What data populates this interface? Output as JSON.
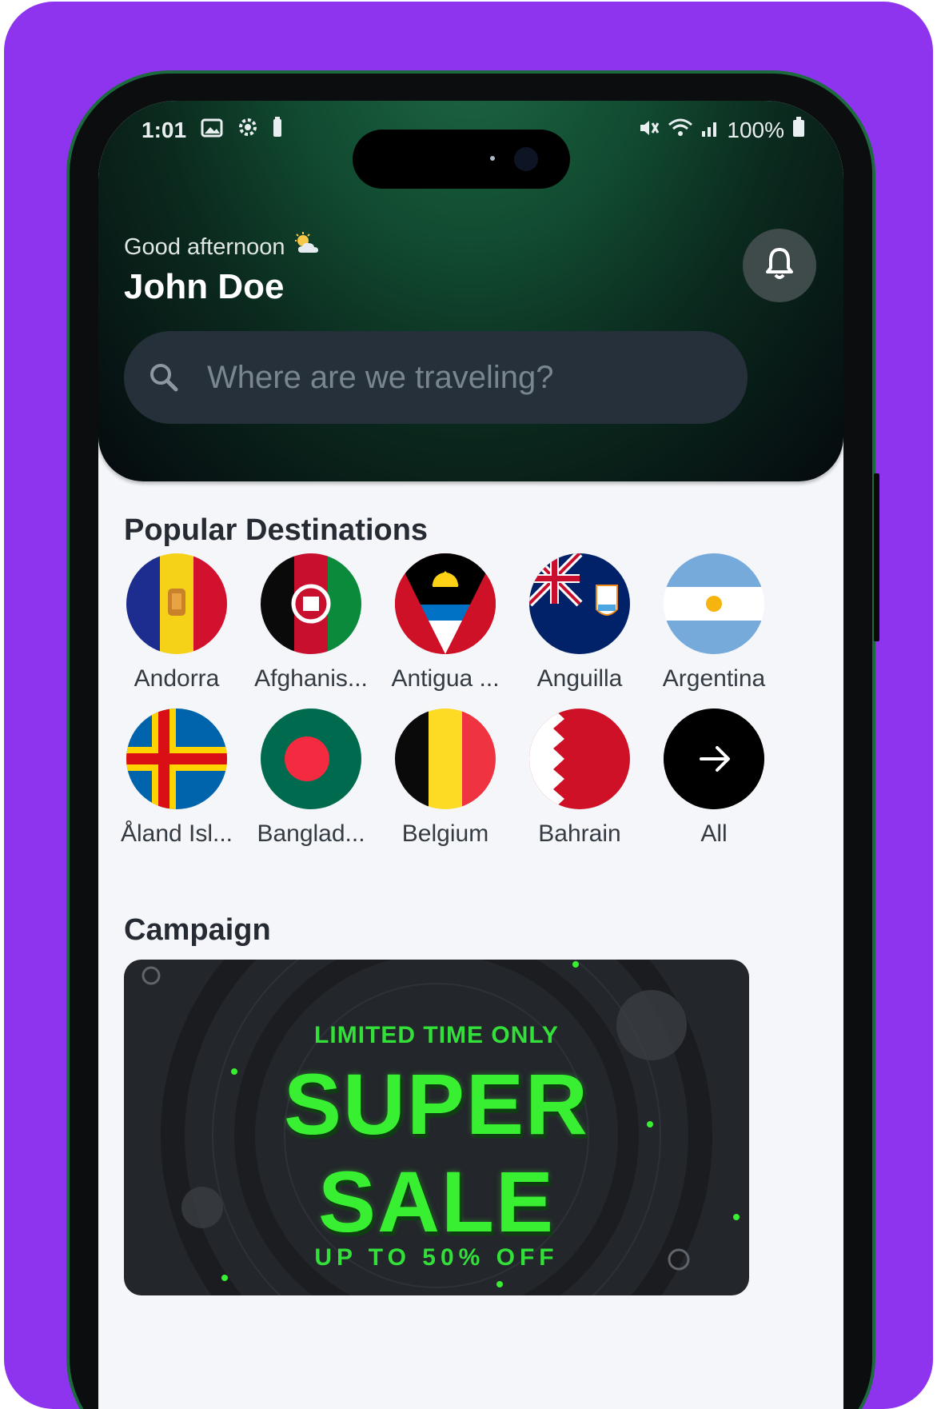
{
  "status_bar": {
    "time": "1:01",
    "battery": "100%",
    "icons": [
      "image-icon",
      "gear-icon",
      "battery-saver-icon",
      "mute-icon",
      "wifi-icon",
      "signal-icon",
      "battery-icon"
    ]
  },
  "header": {
    "greeting": "Good afternoon",
    "weather_icon": "sun-cloud-icon",
    "user_name": "John Doe",
    "notification_icon": "bell-icon"
  },
  "search": {
    "placeholder": "Where are we traveling?",
    "icon": "search-icon"
  },
  "popular": {
    "title": "Popular Destinations",
    "items": [
      {
        "label": "Andorra",
        "flag": "andorra"
      },
      {
        "label": "Afghanis...",
        "flag": "afghanistan"
      },
      {
        "label": "Antigua ...",
        "flag": "antigua"
      },
      {
        "label": "Anguilla",
        "flag": "anguilla"
      },
      {
        "label": "Argentina",
        "flag": "argentina"
      },
      {
        "label": "Åland Isl...",
        "flag": "aland"
      },
      {
        "label": "Banglad...",
        "flag": "bangladesh"
      },
      {
        "label": "Belgium",
        "flag": "belgium"
      },
      {
        "label": "Bahrain",
        "flag": "bahrain"
      },
      {
        "label": "All",
        "flag": "all"
      }
    ]
  },
  "campaign": {
    "title": "Campaign",
    "line1": "LIMITED TIME ONLY",
    "line2": "SUPER",
    "line3": "SALE",
    "line4": "UP TO 50% OFF"
  },
  "colors": {
    "frame": "#8e34ee",
    "accent_green": "#38f031",
    "header_green": "#114a30"
  }
}
